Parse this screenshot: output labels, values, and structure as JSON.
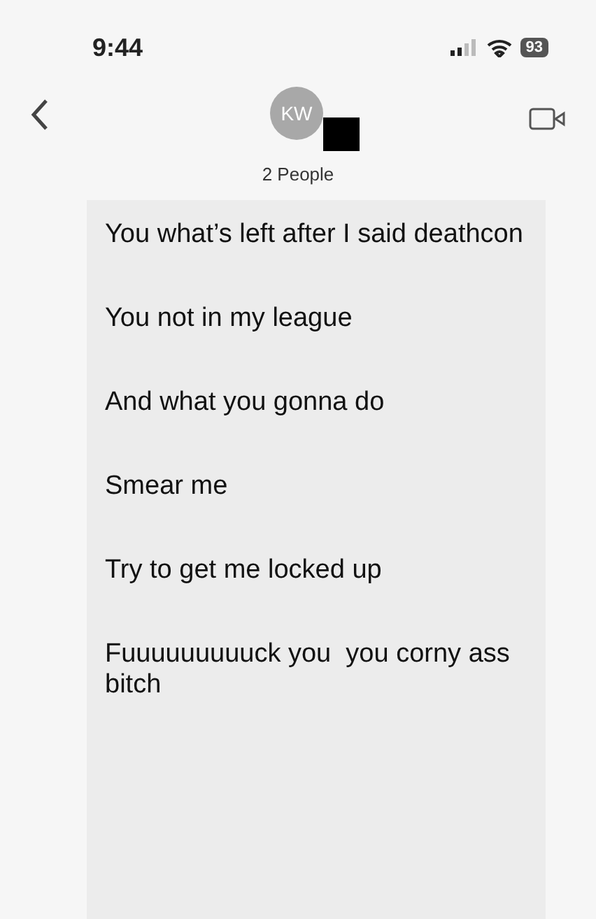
{
  "status_bar": {
    "time": "9:44",
    "battery": "93"
  },
  "header": {
    "avatar_initials": "KW",
    "redacted": true,
    "subtitle": "2 People"
  },
  "messages": [
    {
      "text": "You what’s left after I said deathcon"
    },
    {
      "text": "You not in my league"
    },
    {
      "text": "And what you gonna do"
    },
    {
      "text": "Smear me"
    },
    {
      "text": "Try to get me locked up"
    },
    {
      "text": "Fuuuuuuuuuck you  you corny ass bitch"
    }
  ]
}
